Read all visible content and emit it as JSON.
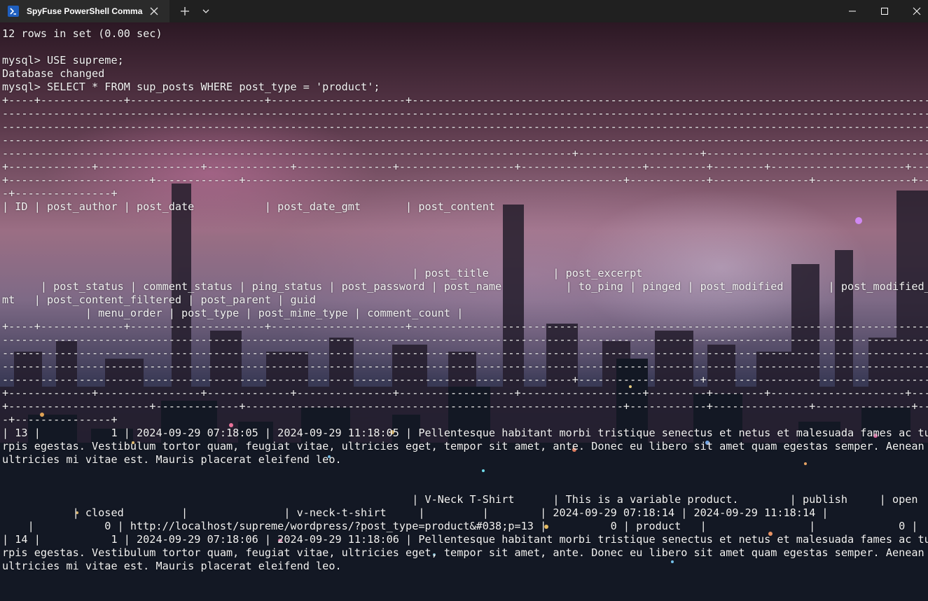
{
  "window": {
    "tab_title": "SpyFuse PowerShell Command",
    "icons": {
      "tab": "powershell-icon",
      "tab_close": "close-icon",
      "new_tab": "plus-icon",
      "dropdown": "chevron-down-icon",
      "minimize": "minimize-icon",
      "maximize": "maximize-icon",
      "close": "close-icon"
    },
    "colors": {
      "titlebar": "#202020",
      "active_tab": "#2b2b2b",
      "text": "#f2f2f2"
    }
  },
  "terminal": {
    "lines": [
      "12 rows in set (0.00 sec)",
      "",
      "mysql> USE supreme;",
      "Database changed",
      "mysql> SELECT * FROM sup_posts WHERE post_type = 'product';",
      "+----+-------------+---------------------+---------------------+--------------------------------------------------------------------------------------------------------------------------------------------",
      "--------------------------------------------------------------------------------------------------------------------------------------------------------------------------------------------------------",
      "--------------------------------------------------------------------------------------------------------------------------------------------------------------------------------------------------------",
      "--------------------------------------------------------------------------------------------------------------------------------------------------------------------------------------------------------",
      "-----------------------------------------------------------------------------------------+-------------------+-------------------------------------------------------------------------------------------------",
      "+-------------+----------------+-------------+---------------+------------------+-------------------+---------+--------+---------------------+---------------------+--------------------------------------",
      "+----------------------+-------------+-----------------------------------------------------------+------------+---------------+---------------+-----------+-------------+----------------+---------------",
      "-+---------------+",
      "| ID | post_author | post_date           | post_date_gmt       | post_content",
      "",
      "",
      "",
      "",
      "                                                                | post_title          | post_excerpt",
      "      | post_status | comment_status | ping_status | post_password | post_name          | to_ping | pinged | post_modified       | post_modified_g",
      "mt   | post_content_filtered | post_parent | guid",
      "             | menu_order | post_type | post_mime_type | comment_count |",
      "+----+-------------+---------------------+---------------------+--------------------------------------------------------------------------------------------------------------------------------------------",
      "--------------------------------------------------------------------------------------------------------------------------------------------------------------------------------------------------------",
      "--------------------------------------------------------------------------------------------------------------------------------------------------------------------------------------------------------",
      "--------------------------------------------------------------------------------------------------------------------------------------------------------------------------------------------------------",
      "-----------------------------------------------------------------------------------------+-------------------+-------------------------------------------------------------------------------------------------",
      "+-------------+----------------+-------------+---------------+------------------+-------------------+---------+--------+---------------------+---------------------+--------------------------------------",
      "+----------------------+-------------+-----------------------------------------------------------+------------+---------------+---------------+-----------+-------------+----------------+---------------",
      "-+---------------+",
      "| 13 |           1 | 2024-09-29 07:18:05 | 2024-09-29 11:18:05 | Pellentesque habitant morbi tristique senectus et netus et malesuada fames ac tu",
      "rpis egestas. Vestibulum tortor quam, feugiat vitae, ultricies eget, tempor sit amet, ante. Donec eu libero sit amet quam egestas semper. Aenean",
      "ultricies mi vitae est. Mauris placerat eleifend leo.",
      "",
      "",
      "                                                                | V-Neck T-Shirt      | This is a variable product.        | publish     | open",
      "           | closed         |               | v-neck-t-shirt     |         |        | 2024-09-29 07:18:14 | 2024-09-29 11:18:14 |",
      "    |           0 | http://localhost/supreme/wordpress/?post_type=product&#038;p=13 |          0 | product   |                |             0 |",
      "| 14 |           1 | 2024-09-29 07:18:06 | 2024-09-29 11:18:06 | Pellentesque habitant morbi tristique senectus et netus et malesuada fames ac tu",
      "rpis egestas. Vestibulum tortor quam, feugiat vitae, ultricies eget, tempor sit amet, ante. Donec eu libero sit amet quam egestas semper. Aenean",
      "ultricies mi vitae est. Mauris placerat eleifend leo."
    ]
  }
}
